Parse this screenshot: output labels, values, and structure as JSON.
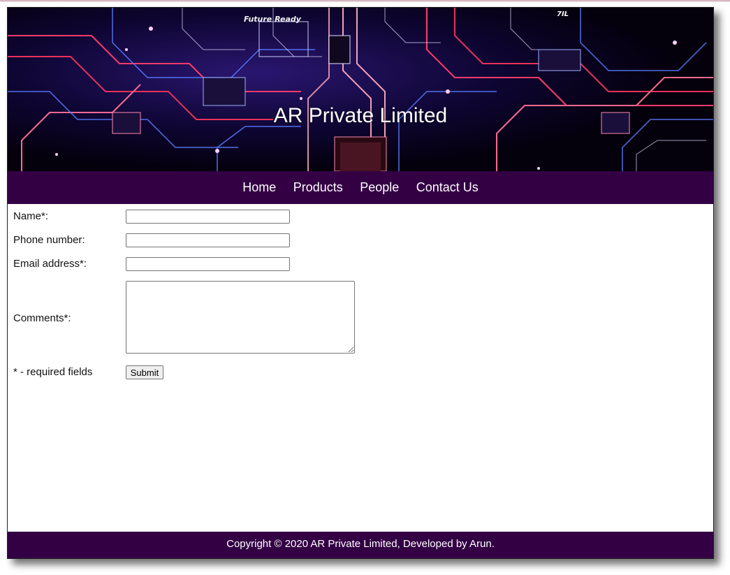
{
  "header": {
    "title": "AR Private Limited",
    "banner_tagline": "Future Ready",
    "banner_logo": "7IL"
  },
  "nav": {
    "items": [
      {
        "label": "Home"
      },
      {
        "label": "Products"
      },
      {
        "label": "People"
      },
      {
        "label": "Contact Us"
      }
    ]
  },
  "form": {
    "name_label": "Name*:",
    "phone_label": "Phone number:",
    "email_label": "Email address*:",
    "comments_label": "Comments*:",
    "required_note": "* - required fields",
    "submit_label": "Submit",
    "name_value": "",
    "phone_value": "",
    "email_value": "",
    "comments_value": ""
  },
  "footer": {
    "text": "Copyright © 2020 AR Private Limited, Developed by Arun."
  },
  "colors": {
    "nav_background": "#330044",
    "footer_background": "#330044",
    "text_on_dark": "#ffffff"
  }
}
